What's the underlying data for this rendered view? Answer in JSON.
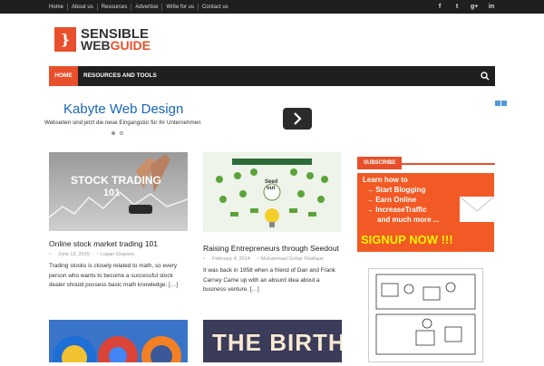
{
  "topnav": {
    "items": [
      "Home",
      "About us",
      "Resources",
      "Advertise",
      "Write for us",
      "Contact us"
    ]
  },
  "social": [
    "f",
    "t",
    "g+",
    "in"
  ],
  "logo": {
    "mark": "}",
    "line1": "SENSIBLE",
    "line2a": "WEB",
    "line2b": "GUIDE"
  },
  "mainnav": {
    "home": "HOME",
    "resources": "RESOURCES AND TOOLS"
  },
  "ad": {
    "title": "Kabyte Web Design",
    "subtitle": "Webseiten sind jetzt die neue Eingangstür für Ihr Unternehmen"
  },
  "posts": [
    {
      "title": "Online stock market trading 101",
      "date": "June 13, 2015",
      "author": "Logan Grayson",
      "excerpt": "Trading stocks is closely related to math, so every person who wants to become a successful stock dealer should possess basic math knowledge. […]",
      "image_text_1": "STOCK TRADING",
      "image_text_2": "101"
    },
    {
      "title": "Raising Entrepreneurs through Seedout",
      "date": "February 4, 2014",
      "author": "Muhammad Gohar Shafique",
      "excerpt": "It was back in 1958 when a friend of Dan and Frank Carney Came up with an absurd idea about a business venture. […]",
      "image_text_1": "Seed",
      "image_text_2": "out"
    }
  ],
  "bottom_card_2_text": "THE BIRTH",
  "sidebar": {
    "subscribe_heading": "SUBSCRIBE",
    "banner_lines": [
      "Learn how to",
      "→ Start Blogging",
      "→ Earn Online",
      "→ IncreaseTraffic",
      "and much more ..."
    ],
    "banner_cta": "SIGNUP NOW !!!"
  },
  "colors": {
    "accent": "#e8502b",
    "dark": "#1f1f1f",
    "link_blue": "#1a66b8"
  }
}
